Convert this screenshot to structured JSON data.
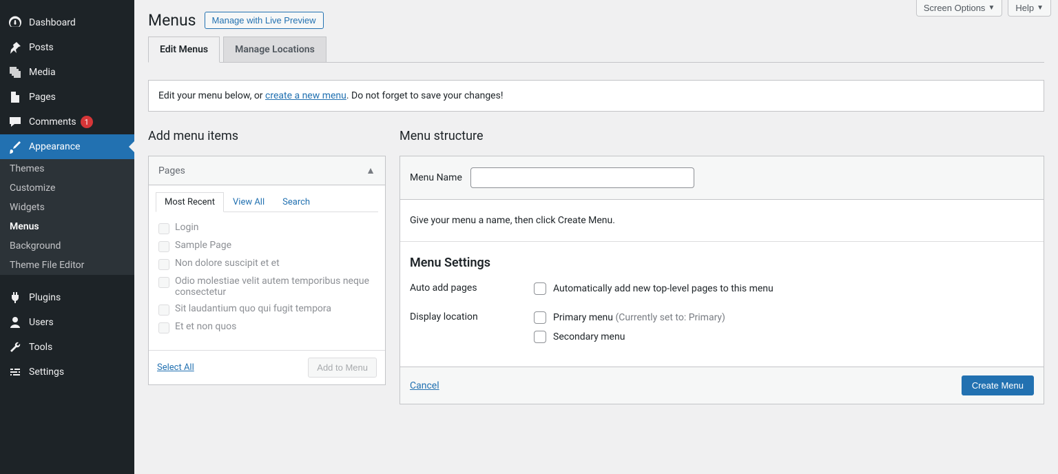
{
  "sidebar": {
    "dashboard": "Dashboard",
    "posts": "Posts",
    "media": "Media",
    "pages": "Pages",
    "comments": "Comments",
    "comments_count": "1",
    "appearance": "Appearance",
    "plugins": "Plugins",
    "users": "Users",
    "tools": "Tools",
    "settings": "Settings",
    "submenu": {
      "themes": "Themes",
      "customize": "Customize",
      "widgets": "Widgets",
      "menus": "Menus",
      "background": "Background",
      "file_editor": "Theme File Editor"
    }
  },
  "top": {
    "screen_options": "Screen Options",
    "help": "Help"
  },
  "page": {
    "title": "Menus",
    "live_preview": "Manage with Live Preview"
  },
  "tabs": {
    "edit": "Edit Menus",
    "locations": "Manage Locations"
  },
  "notice": {
    "prefix": "Edit your menu below, or ",
    "link": "create a new menu",
    "suffix": ". Do not forget to save your changes!"
  },
  "left": {
    "heading": "Add menu items",
    "pages_label": "Pages",
    "inner_tabs": {
      "recent": "Most Recent",
      "all": "View All",
      "search": "Search"
    },
    "items": [
      "Login",
      "Sample Page",
      "Non dolore suscipit et et",
      "Odio molestiae velit autem temporibus neque consectetur",
      "Sit laudantium quo qui fugit tempora",
      "Et et non quos"
    ],
    "select_all": "Select All",
    "add_to_menu": "Add to Menu"
  },
  "right": {
    "heading": "Menu structure",
    "name_label": "Menu Name",
    "instructions": "Give your menu a name, then click Create Menu.",
    "settings_heading": "Menu Settings",
    "auto_add_label": "Auto add pages",
    "auto_add_option": "Automatically add new top-level pages to this menu",
    "display_label": "Display location",
    "primary": "Primary menu",
    "primary_note": "(Currently set to: Primary)",
    "secondary": "Secondary menu",
    "cancel": "Cancel",
    "create": "Create Menu"
  }
}
